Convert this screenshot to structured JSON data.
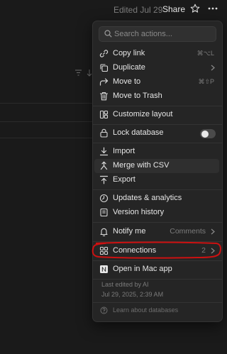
{
  "topbar": {
    "edited": "Edited Jul 29",
    "share": "Share"
  },
  "search": {
    "placeholder": "Search actions..."
  },
  "items": {
    "copy_link": {
      "label": "Copy link",
      "shortcut": "⌘⌥L"
    },
    "duplicate": {
      "label": "Duplicate"
    },
    "move_to": {
      "label": "Move to",
      "shortcut": "⌘⇧P"
    },
    "move_to_trash": {
      "label": "Move to Trash"
    },
    "customize_layout": {
      "label": "Customize layout"
    },
    "lock_database": {
      "label": "Lock database",
      "toggle_on": false
    },
    "import": {
      "label": "Import"
    },
    "merge_csv": {
      "label": "Merge with CSV"
    },
    "export": {
      "label": "Export"
    },
    "updates": {
      "label": "Updates & analytics"
    },
    "version_history": {
      "label": "Version history"
    },
    "notify_me": {
      "label": "Notify me",
      "value": "Comments"
    },
    "connections": {
      "label": "Connections",
      "count": "2"
    },
    "open_mac": {
      "label": "Open in Mac app"
    }
  },
  "footer": {
    "last_edited_by": "Last edited by AI",
    "last_edited_date": "Jul 29, 2025, 2:39 AM",
    "learn": "Learn about databases"
  },
  "colors": {
    "highlight_ring": "#cc1111",
    "menu_bg": "#252525",
    "page_bg": "#1a1a1a"
  }
}
